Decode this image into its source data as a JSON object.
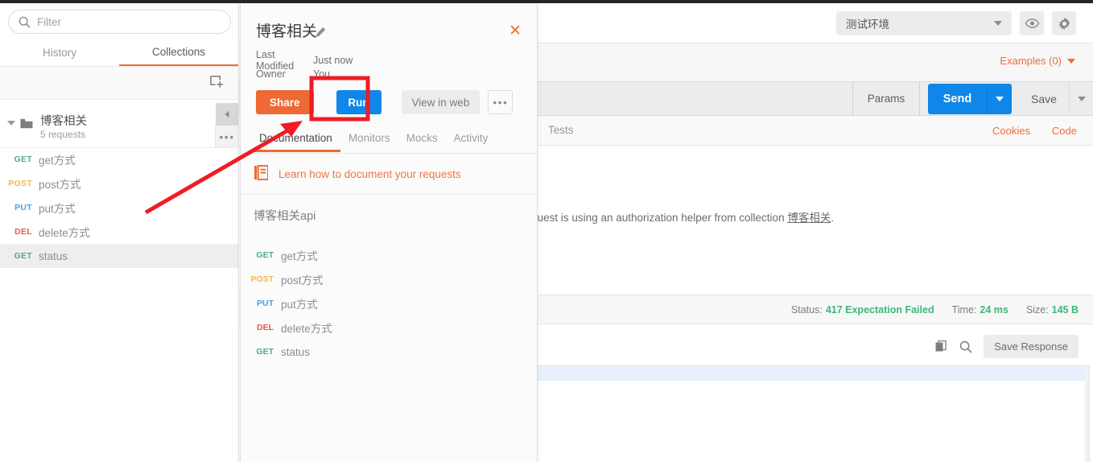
{
  "sidebar": {
    "search": {
      "placeholder": "Filter",
      "value": "",
      "icon": "search-icon"
    },
    "tabs": [
      {
        "label": "History",
        "active": false
      },
      {
        "label": "Collections",
        "active": true
      }
    ],
    "new_collection_icon": "new-collection-icon",
    "collection": {
      "name": "博客相关",
      "subtitle": "5 requests",
      "folder_icon": "folder-icon",
      "caret_icon": "caret-down-icon",
      "collapse_icon": "collapse-left-icon",
      "more_icon": "ellipsis-icon"
    },
    "requests": [
      {
        "method": "GET",
        "name": "get方式",
        "selected": false
      },
      {
        "method": "POST",
        "name": "post方式",
        "selected": false
      },
      {
        "method": "PUT",
        "name": "put方式",
        "selected": false
      },
      {
        "method": "DEL",
        "name": "delete方式",
        "selected": false
      },
      {
        "method": "GET",
        "name": "status",
        "selected": true
      }
    ]
  },
  "header": {
    "environment": {
      "value": "测试环境",
      "caret": "chevron-down-icon"
    },
    "eye_icon": "eye-icon",
    "gear_icon": "gear-icon",
    "examples_label": "Examples (0)"
  },
  "request_bar": {
    "params_label": "Params",
    "send_label": "Send",
    "save_label": "Save"
  },
  "request_tabs": {
    "tests_label": "Tests",
    "cookies_label": "Cookies",
    "code_label": "Code"
  },
  "body_area": {
    "auth_note_prefix": "This request is using an authorization helper from collection ",
    "auth_note_link": "博客相关",
    "auth_note_suffix": "."
  },
  "response": {
    "status_label": "Status:",
    "status_value": "417 Expectation Failed",
    "time_label": "Time:",
    "time_value": "24 ms",
    "size_label": "Size:",
    "size_value": "145 B",
    "copy_icon": "copy-icon",
    "search_icon": "search-icon",
    "save_response_label": "Save Response"
  },
  "modal": {
    "title": "博客相关",
    "edit_icon": "pencil-icon",
    "close_icon": "close-icon",
    "meta": [
      {
        "key": "Last Modified",
        "value": "Just now"
      },
      {
        "key": "Owner",
        "value": "You"
      }
    ],
    "buttons": {
      "share": "Share",
      "run": "Run",
      "view_in_web": "View in web",
      "more_icon": "ellipsis-icon"
    },
    "tabs": [
      {
        "label": "Documentation",
        "active": true
      },
      {
        "label": "Monitors",
        "active": false
      },
      {
        "label": "Mocks",
        "active": false
      },
      {
        "label": "Activity",
        "active": false
      }
    ],
    "learn_link": "Learn how to document your requests",
    "learn_icon": "book-icon",
    "doc_title": "博客相关api",
    "doc_requests": [
      {
        "method": "GET",
        "name": "get方式"
      },
      {
        "method": "POST",
        "name": "post方式"
      },
      {
        "method": "PUT",
        "name": "put方式"
      },
      {
        "method": "DEL",
        "name": "delete方式"
      },
      {
        "method": "GET",
        "name": "status"
      }
    ]
  },
  "colors": {
    "accent_orange": "#f26b3a",
    "primary_blue": "#0f87e8",
    "share_orange": "#ee6a34",
    "status_green": "#3cb878",
    "method_get": "#4caf82",
    "method_post": "#f4b942",
    "method_put": "#3ea6f0",
    "method_del": "#ef5350",
    "annotation_red": "#ee1c25"
  }
}
